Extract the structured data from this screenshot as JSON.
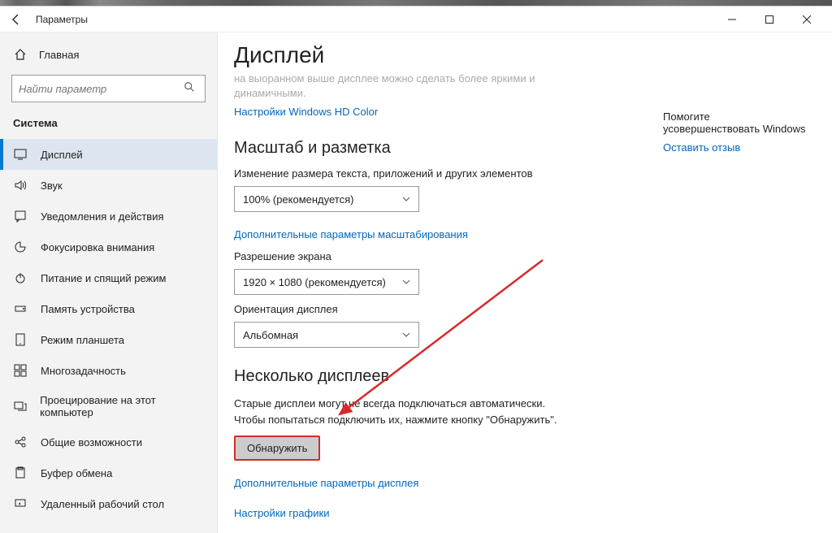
{
  "window": {
    "title": "Параметры",
    "controls": {
      "minimize": "—",
      "maximize": "☐",
      "close": "✕"
    }
  },
  "sidebar": {
    "home": "Главная",
    "search_placeholder": "Найти параметр",
    "section": "Система",
    "items": [
      {
        "label": "Дисплей",
        "icon": "display"
      },
      {
        "label": "Звук",
        "icon": "sound"
      },
      {
        "label": "Уведомления и действия",
        "icon": "notifications"
      },
      {
        "label": "Фокусировка внимания",
        "icon": "focus"
      },
      {
        "label": "Питание и спящий режим",
        "icon": "power"
      },
      {
        "label": "Память устройства",
        "icon": "storage"
      },
      {
        "label": "Режим планшета",
        "icon": "tablet"
      },
      {
        "label": "Многозадачность",
        "icon": "multitask"
      },
      {
        "label": "Проецирование на этот компьютер",
        "icon": "project"
      },
      {
        "label": "Общие возможности",
        "icon": "shared"
      },
      {
        "label": "Буфер обмена",
        "icon": "clipboard"
      },
      {
        "label": "Удаленный рабочий стол",
        "icon": "remote"
      }
    ]
  },
  "content": {
    "title": "Дисплей",
    "hdr_note": "на выоранном выше дисплее можно сделать более яркими и динамичными.",
    "hdr_link": "Настройки Windows HD Color",
    "scale_heading": "Масштаб и разметка",
    "scale_label": "Изменение размера текста, приложений и других элементов",
    "scale_value": "100% (рекомендуется)",
    "scale_link": "Дополнительные параметры масштабирования",
    "res_label": "Разрешение экрана",
    "res_value": "1920 × 1080 (рекомендуется)",
    "orient_label": "Ориентация дисплея",
    "orient_value": "Альбомная",
    "multi_heading": "Несколько дисплеев",
    "multi_desc1": "Старые дисплеи могут не всегда подключаться автоматически.",
    "multi_desc2": "Чтобы попытаться подключить их, нажмите кнопку \"Обнаружить\".",
    "detect_btn": "Обнаружить",
    "adv_display_link": "Дополнительные параметры дисплея",
    "graphics_link": "Настройки графики"
  },
  "right": {
    "help": "Помогите усовершенствовать Windows",
    "feedback": "Оставить отзыв"
  }
}
